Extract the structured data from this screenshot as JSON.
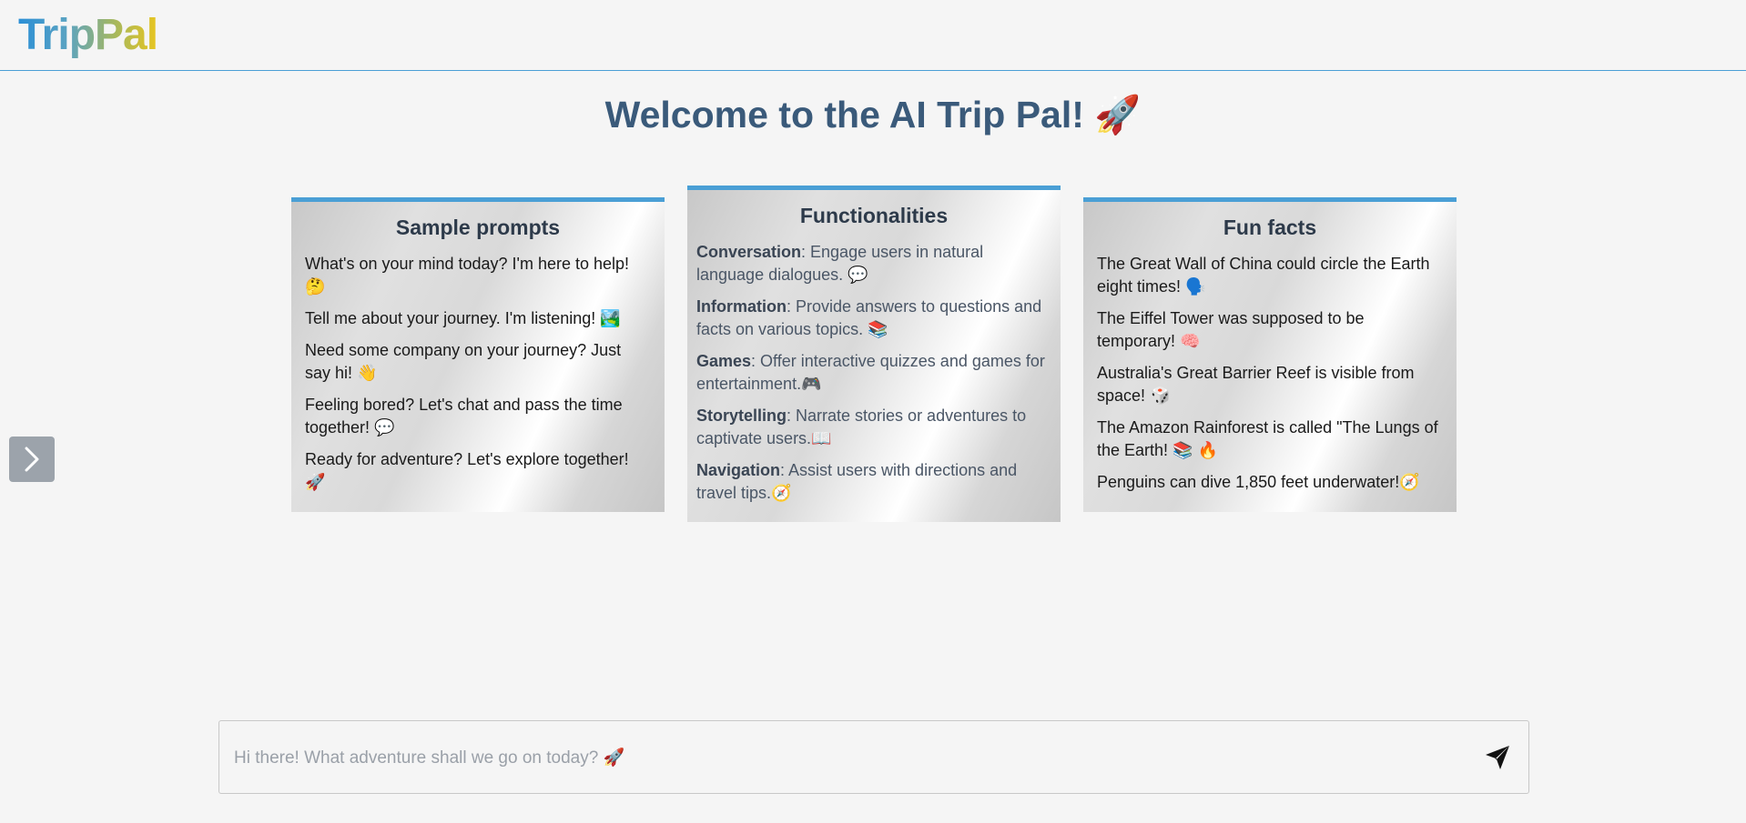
{
  "app": {
    "logo": "TripPal"
  },
  "welcome": {
    "title": "Welcome to the AI Trip Pal! 🚀"
  },
  "sample_prompts": {
    "title": "Sample prompts",
    "items": [
      "What's on your mind today? I'm here to help! 🤔",
      "Tell me about your journey. I'm listening! 🏞️",
      "Need some company on your journey? Just say hi! 👋",
      "Feeling bored? Let's chat and pass the time together! 💬",
      "Ready for adventure? Let's explore together! 🚀"
    ]
  },
  "functionalities": {
    "title": "Functionalities",
    "items": [
      {
        "name": "Conversation",
        "desc": ": Engage users in natural language dialogues. 💬"
      },
      {
        "name": "Information",
        "desc": ": Provide answers to questions and facts on various topics. 📚"
      },
      {
        "name": "Games",
        "desc": ": Offer interactive quizzes and games for entertainment.🎮"
      },
      {
        "name": "Storytelling",
        "desc": ": Narrate stories or adventures to captivate users.📖"
      },
      {
        "name": "Navigation",
        "desc": ": Assist users with directions and travel tips.🧭"
      }
    ]
  },
  "fun_facts": {
    "title": "Fun facts",
    "items": [
      "The Great Wall of China could circle the Earth eight times! 🗣️",
      "The Eiffel Tower was supposed to be temporary! 🧠",
      "Australia's Great Barrier Reef is visible from space! 🎲",
      "The Amazon Rainforest is called \"The Lungs of the Earth! 📚 🔥",
      "Penguins can dive 1,850 feet underwater!🧭"
    ]
  },
  "chat": {
    "placeholder": "Hi there! What adventure shall we go on today? 🚀"
  },
  "icons": {
    "side_toggle": "chevron-right-icon",
    "send": "send-icon"
  },
  "colors": {
    "accent": "#4a9fd5",
    "heading": "#3a5a7a",
    "toggle_bg": "#9ca3ab"
  }
}
